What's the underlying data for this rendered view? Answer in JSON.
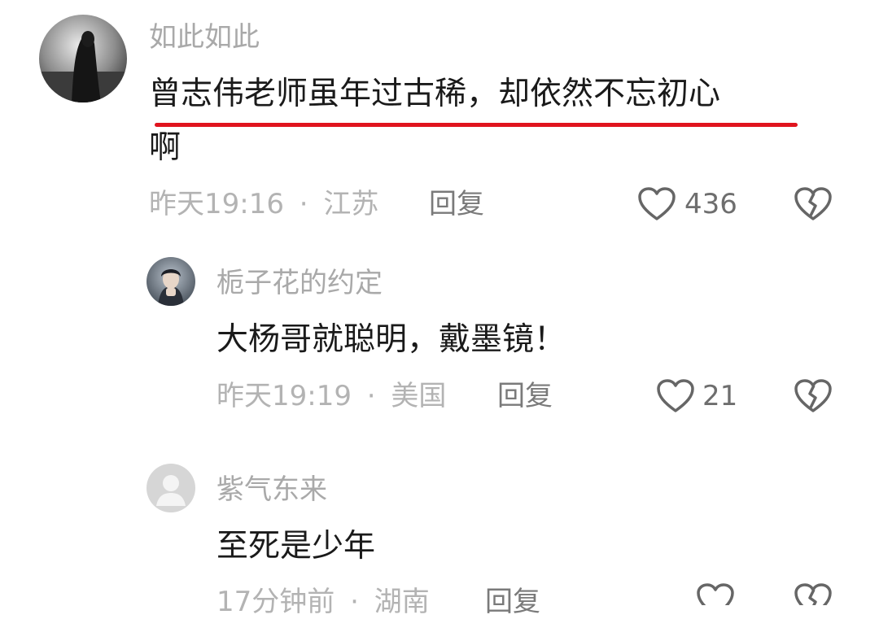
{
  "comments": [
    {
      "username": "如此如此",
      "text_line1": "曾志伟老师虽年过古稀，却依然不忘初心",
      "text_line2": "啊",
      "time": "昨天19:16",
      "separator": "·",
      "location": "江苏",
      "reply_label": "回复",
      "likes": "436",
      "highlight_color": "#e0141e"
    }
  ],
  "replies": [
    {
      "username": "栀子花的约定",
      "text": "大杨哥就聪明，戴墨镜！",
      "time": "昨天19:19",
      "separator": "·",
      "location": "美国",
      "reply_label": "回复",
      "likes": "21"
    },
    {
      "username": "紫气东来",
      "text": "至死是少年",
      "time": "17分钟前",
      "separator": "·",
      "location": "湖南",
      "reply_label": "回复"
    }
  ],
  "icons": {
    "like": "heart-outline-icon",
    "dislike": "broken-heart-icon",
    "default_avatar": "person-silhouette-icon"
  }
}
